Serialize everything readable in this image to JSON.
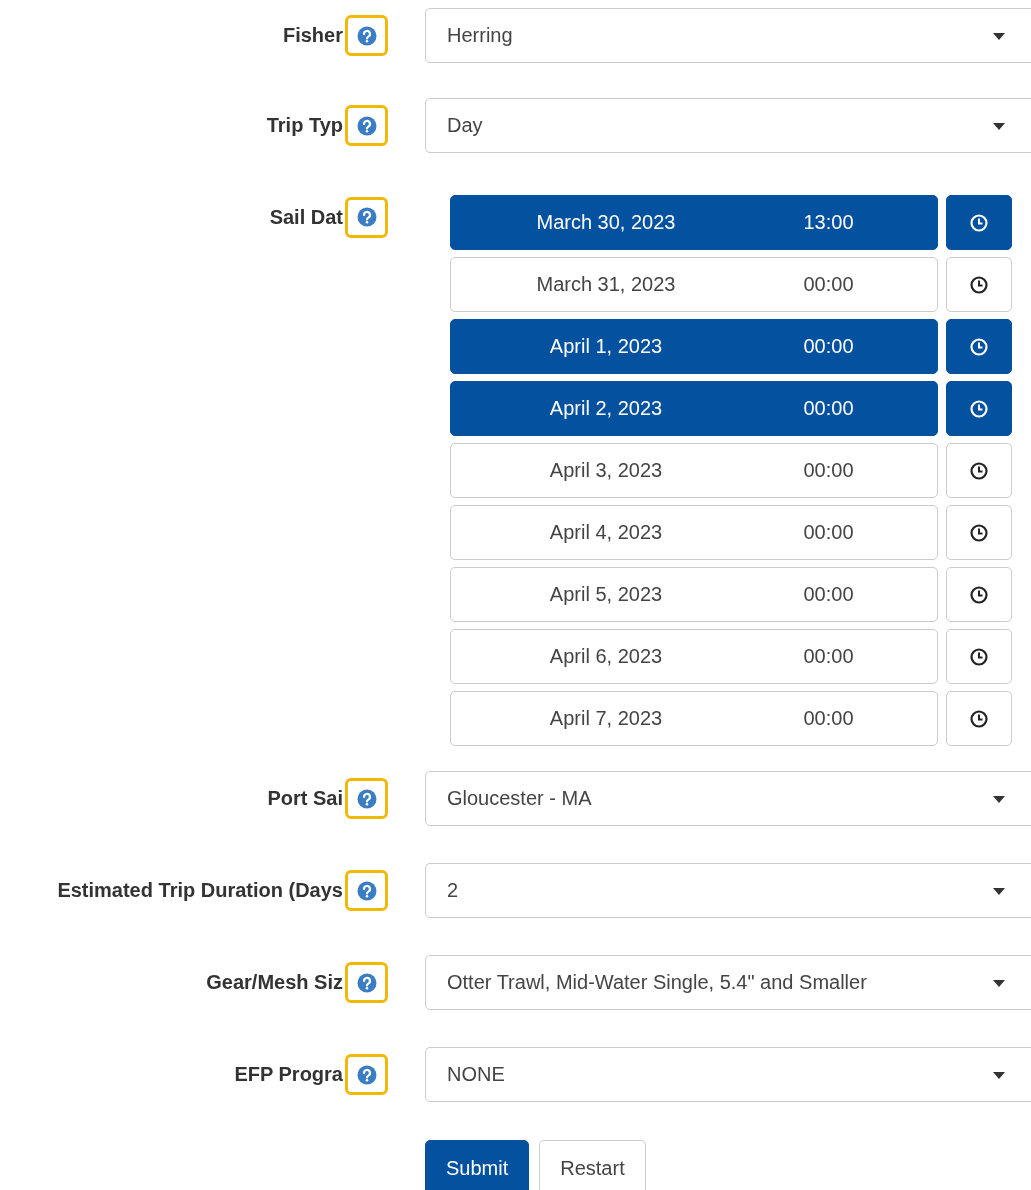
{
  "fields_top": [
    {
      "label": "Fisher",
      "value": "Herring"
    },
    {
      "label": "Trip Typ",
      "value": "Day"
    }
  ],
  "sail_date": {
    "label": "Sail Dat",
    "dates": [
      {
        "date": "March 30, 2023",
        "time": "13:00",
        "selected": true
      },
      {
        "date": "March 31, 2023",
        "time": "00:00",
        "selected": false
      },
      {
        "date": "April 1, 2023",
        "time": "00:00",
        "selected": true
      },
      {
        "date": "April 2, 2023",
        "time": "00:00",
        "selected": true
      },
      {
        "date": "April 3, 2023",
        "time": "00:00",
        "selected": false
      },
      {
        "date": "April 4, 2023",
        "time": "00:00",
        "selected": false
      },
      {
        "date": "April 5, 2023",
        "time": "00:00",
        "selected": false
      },
      {
        "date": "April 6, 2023",
        "time": "00:00",
        "selected": false
      },
      {
        "date": "April 7, 2023",
        "time": "00:00",
        "selected": false
      }
    ]
  },
  "fields_bottom": [
    {
      "label": "Port Sai",
      "value": "Gloucester - MA"
    },
    {
      "label": "Estimated Trip Duration (Days",
      "value": "2"
    },
    {
      "label": "Gear/Mesh Siz",
      "value": "Otter Trawl, Mid-Water Single, 5.4\" and Smaller"
    },
    {
      "label": "EFP Progra",
      "value": "NONE"
    }
  ],
  "buttons": [
    {
      "label": "Submit",
      "kind": "primary"
    },
    {
      "label": "Restart",
      "kind": "default"
    }
  ]
}
